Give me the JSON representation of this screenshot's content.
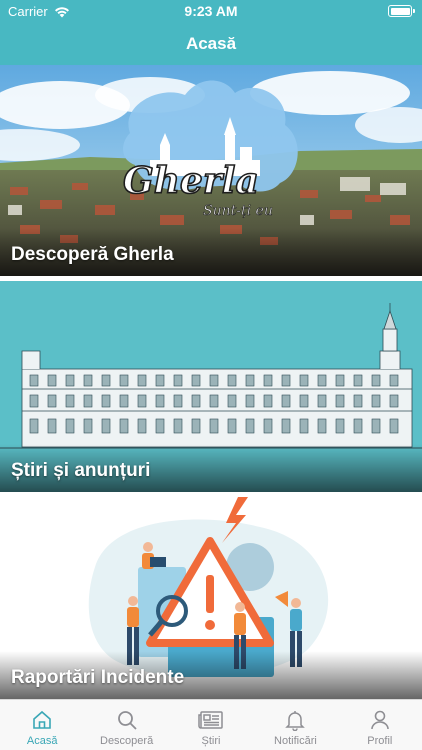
{
  "status_bar": {
    "carrier": "Carrier",
    "time": "9:23 AM"
  },
  "nav": {
    "title": "Acasă"
  },
  "cards": [
    {
      "label": "Descoperă Gherla",
      "logo_main": "Gherla",
      "logo_sub": "Sunt-ți eu"
    },
    {
      "label": "Știri și anunțuri"
    },
    {
      "label": "Raportări Incidente"
    }
  ],
  "tabs": [
    {
      "label": "Acasă",
      "icon": "home-icon",
      "active": true
    },
    {
      "label": "Descoperă",
      "icon": "search-icon",
      "active": false
    },
    {
      "label": "Știri",
      "icon": "newspaper-icon",
      "active": false
    },
    {
      "label": "Notificări",
      "icon": "bell-icon",
      "active": false
    },
    {
      "label": "Profil",
      "icon": "person-icon",
      "active": false
    }
  ],
  "colors": {
    "accent": "#48b8c2",
    "active_tab": "#3aa7b6",
    "inactive_tab": "#8e8e93"
  }
}
